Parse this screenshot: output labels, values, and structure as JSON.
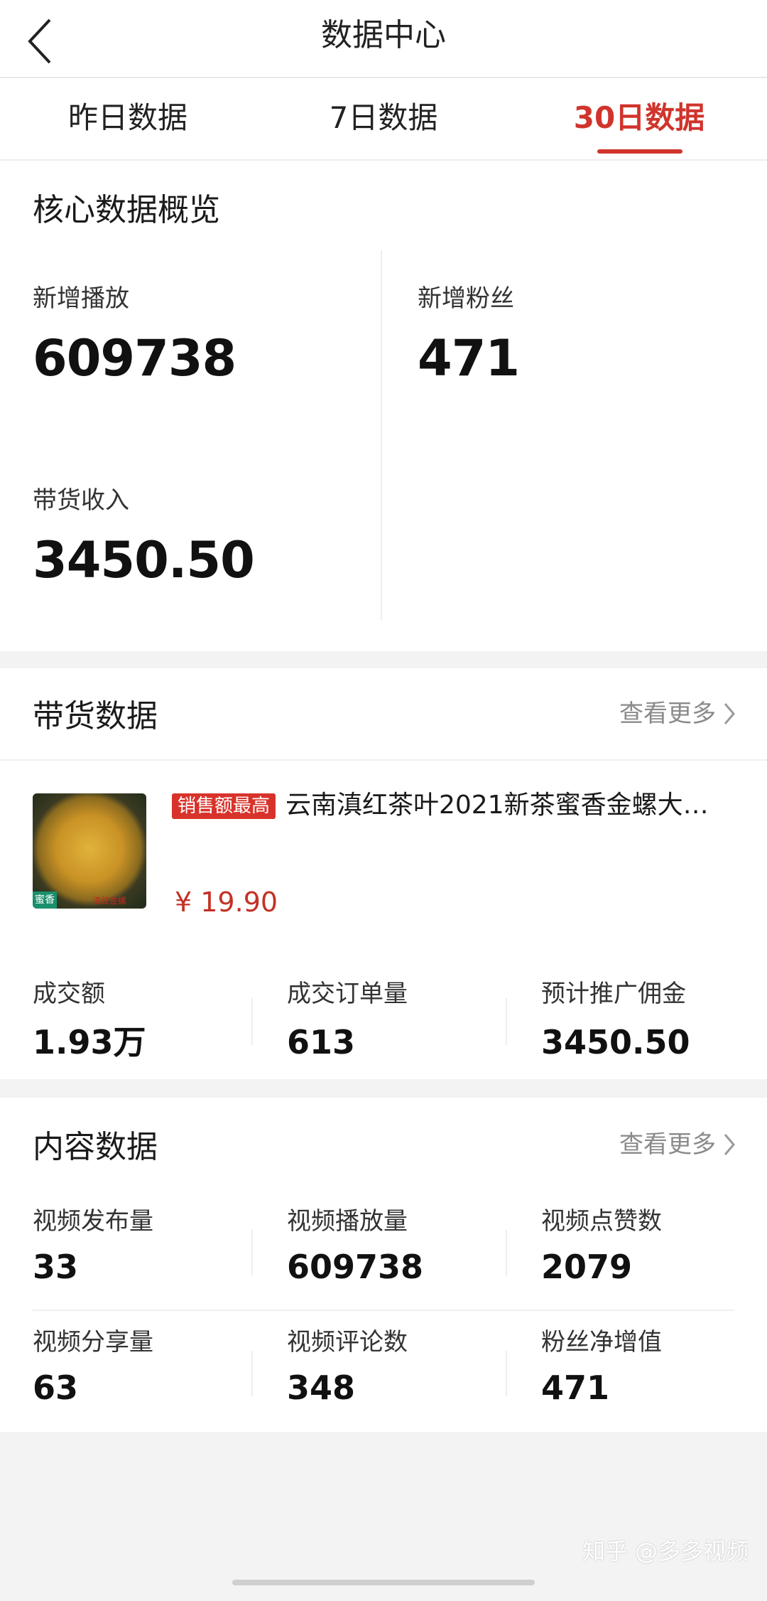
{
  "header": {
    "title": "数据中心"
  },
  "tabs": [
    {
      "label": "昨日数据"
    },
    {
      "label": "7日数据"
    },
    {
      "label": "30日数据"
    }
  ],
  "overview": {
    "title": "核心数据概览",
    "metrics": [
      {
        "label": "新增播放",
        "value": "609738"
      },
      {
        "label": "新增粉丝",
        "value": "471"
      },
      {
        "label": "带货收入",
        "value": "3450.50"
      }
    ]
  },
  "sales": {
    "title": "带货数据",
    "more": "查看更多",
    "product": {
      "tag": "销售额最高",
      "name": "云南滇红茶叶2021新茶蜜香金螺大…",
      "price": "¥ 19.90",
      "thumb_badge": "蜜香",
      "thumb_caption": "滇红金螺"
    },
    "metrics": [
      {
        "label": "成交额",
        "value": "1.93万"
      },
      {
        "label": "成交订单量",
        "value": "613"
      },
      {
        "label": "预计推广佣金",
        "value": "3450.50"
      }
    ]
  },
  "content": {
    "title": "内容数据",
    "more": "查看更多",
    "metrics": [
      {
        "label": "视频发布量",
        "value": "33"
      },
      {
        "label": "视频播放量",
        "value": "609738"
      },
      {
        "label": "视频点赞数",
        "value": "2079"
      },
      {
        "label": "视频分享量",
        "value": "63"
      },
      {
        "label": "视频评论数",
        "value": "348"
      },
      {
        "label": "粉丝净增值",
        "value": "471"
      }
    ]
  },
  "watermark": "知乎 @多多视频",
  "colors": {
    "accent": "#d0342c",
    "price": "#c43126",
    "muted": "#8a8a8a"
  }
}
